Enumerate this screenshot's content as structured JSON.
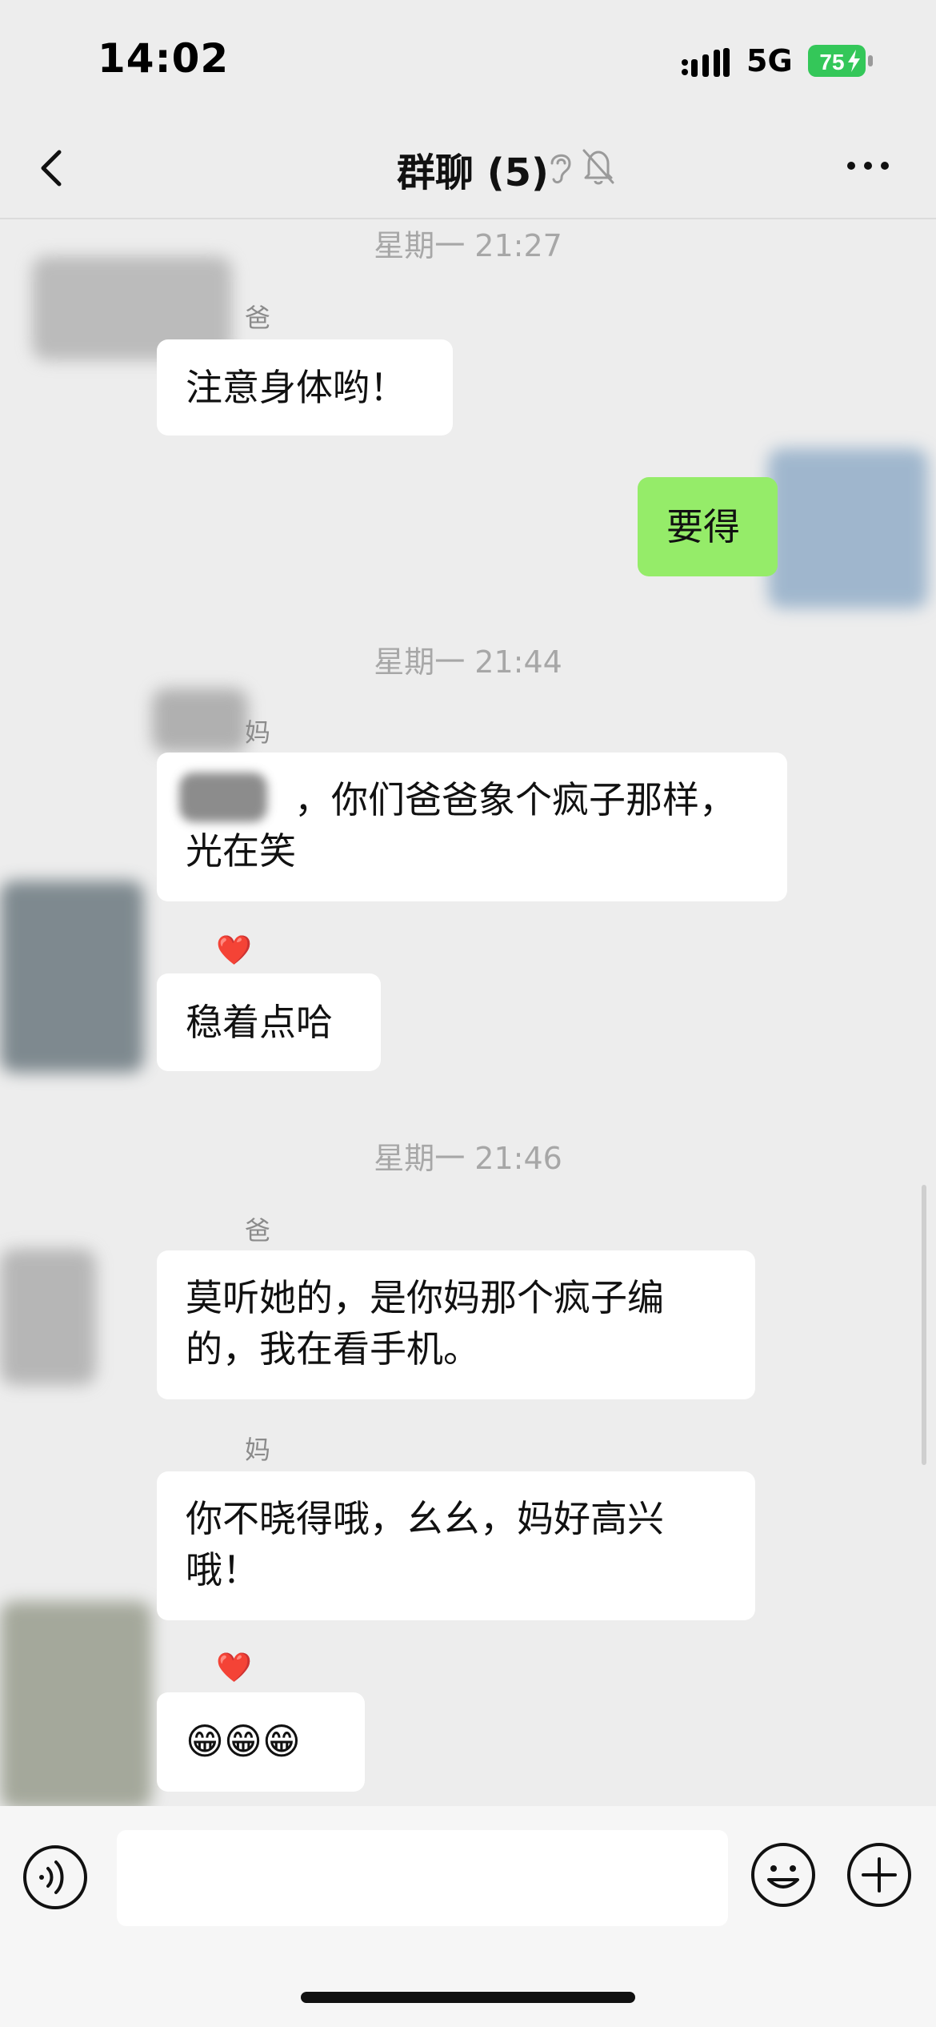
{
  "status_bar": {
    "time": "14:02",
    "network": "5G",
    "battery": "75"
  },
  "nav": {
    "title": "群聊 (5)"
  },
  "messages": [
    {
      "timestamp": "星期一 21:27"
    },
    {
      "sender": "爸",
      "lines": [
        "注意身体哟！"
      ]
    },
    {
      "mine": true,
      "lines": [
        "要得"
      ]
    },
    {
      "timestamp": "星期一 21:44"
    },
    {
      "sender": "妈",
      "lines": [
        "，你们爸爸象个疯子那样，",
        "光在笑"
      ]
    },
    {
      "sender": "❤️",
      "lines": [
        "稳着点哈"
      ]
    },
    {
      "timestamp": "星期一 21:46"
    },
    {
      "sender": "爸",
      "lines": [
        "莫听她的，是你妈那个疯子编",
        "的，我在看手机。"
      ]
    },
    {
      "sender": "妈",
      "lines": [
        "你不晓得哦，幺幺，妈好高兴",
        "哦！"
      ]
    },
    {
      "sender": "❤️",
      "lines": [
        "😁😁😁"
      ]
    }
  ],
  "colors": {
    "background": "#ededed",
    "bubble_other": "#ffffff",
    "bubble_mine": "#95ec69",
    "battery": "#34c759"
  },
  "icons": [
    "back-icon",
    "ear-icon",
    "bell-off-icon",
    "more-icon",
    "voice-icon",
    "emoji-icon",
    "plus-icon"
  ]
}
